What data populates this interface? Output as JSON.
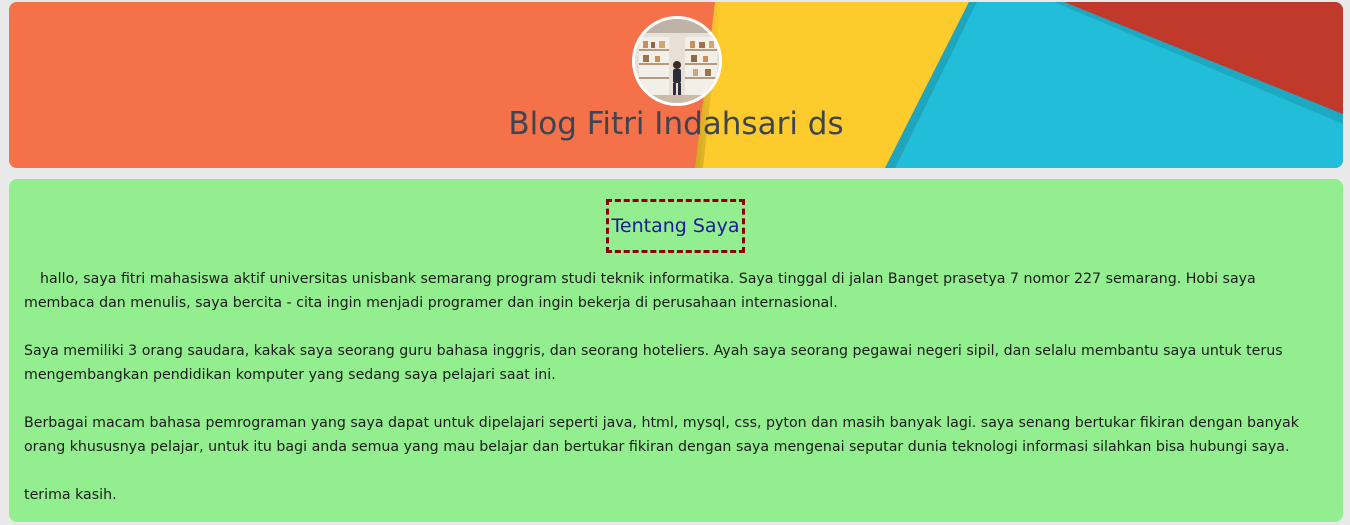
{
  "header": {
    "title": "Blog Fitri Indahsari ds",
    "colors": {
      "orange": "#f4714a",
      "yellow": "#fecb2c",
      "cyan": "#22bdd8",
      "red": "#c0392b",
      "title_text": "#3d4650"
    },
    "avatar_alt": "profile photo"
  },
  "content": {
    "background": "#93ee8f",
    "section_title": "Tentang Saya",
    "paragraphs": [
      "hallo, saya fitri mahasiswa aktif universitas unisbank semarang program studi teknik informatika. Saya tinggal di jalan Banget prasetya 7 nomor 227 semarang. Hobi saya membaca dan menulis, saya bercita - cita ingin menjadi programer dan ingin bekerja di perusahaan internasional.",
      "Saya memiliki 3 orang saudara, kakak saya seorang guru bahasa inggris, dan seorang hoteliers. Ayah saya seorang pegawai negeri sipil, dan selalu membantu saya untuk terus mengembangkan pendidikan komputer yang sedang saya pelajari saat ini.",
      "Berbagai macam bahasa pemrograman yang saya dapat untuk dipelajari seperti java, html, mysql, css, pyton dan masih banyak lagi. saya senang bertukar fikiran dengan banyak orang khususnya pelajar, untuk itu bagi anda semua yang mau belajar dan bertukar fikiran dengan saya mengenai seputar dunia teknologi informasi silahkan bisa hubungi saya.",
      "terima kasih."
    ]
  }
}
